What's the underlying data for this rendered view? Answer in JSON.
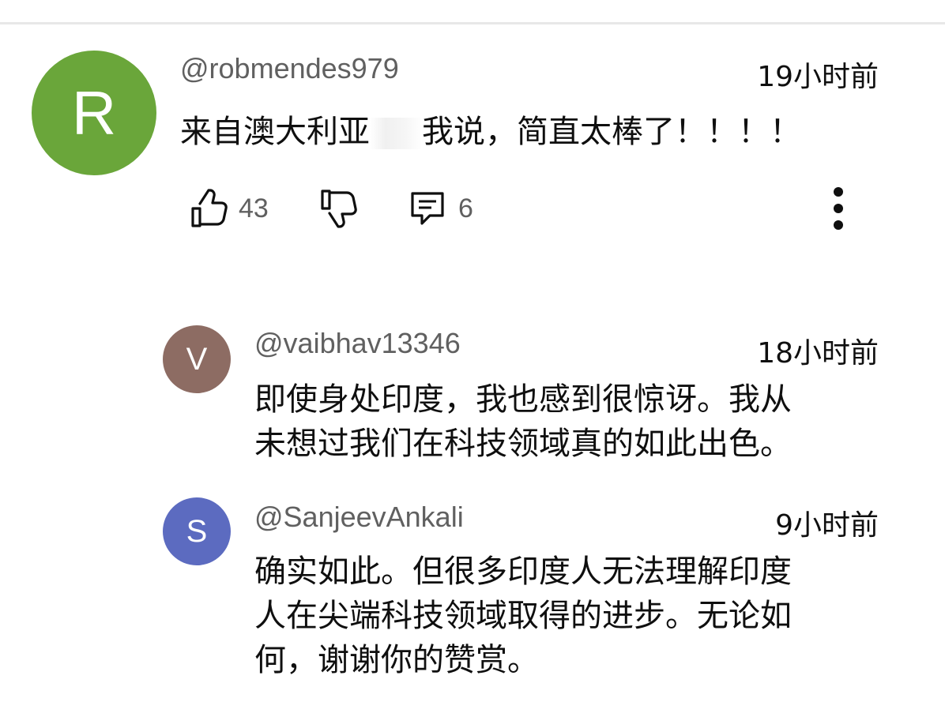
{
  "comment": {
    "avatar_letter": "R",
    "avatar_color": "#6aa63a",
    "handle": "@robmendes979",
    "time": "19小时前",
    "text_before": "来自澳大利亚",
    "text_after": "我说，简直太棒了！！！！",
    "likes": "43",
    "replies": "6",
    "icons": [
      "thumbs-up-icon",
      "thumbs-down-icon",
      "reply-comment-icon",
      "more-vertical-icon"
    ]
  },
  "replies": [
    {
      "avatar_letter": "V",
      "avatar_color": "#8d6c63",
      "handle": "@vaibhav13346",
      "time": "18小时前",
      "lines": [
        "即使身处印度，我也感到很惊讶。我从",
        "未想过我们在科技领域真的如此出色。"
      ]
    },
    {
      "avatar_letter": "S",
      "avatar_color": "#5c6bc0",
      "handle": "@SanjeevAnkali",
      "time": "9小时前",
      "lines": [
        "确实如此。但很多印度人无法理解印度",
        "人在尖端科技领域取得的进步。无论如",
        "何，谢谢你的赞赏。"
      ]
    }
  ]
}
